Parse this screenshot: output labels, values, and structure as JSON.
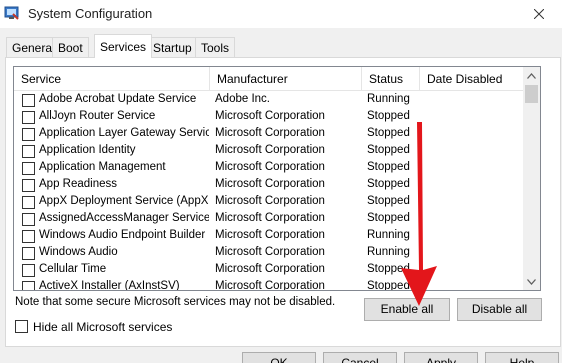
{
  "window": {
    "title": "System Configuration"
  },
  "tabs": [
    "General",
    "Boot",
    "Services",
    "Startup",
    "Tools"
  ],
  "active_tab": "Services",
  "columns": [
    "Service",
    "Manufacturer",
    "Status",
    "Date Disabled"
  ],
  "services": [
    {
      "service": "Adobe Acrobat Update Service",
      "manufacturer": "Adobe Inc.",
      "status": "Running",
      "checked": false
    },
    {
      "service": "AllJoyn Router Service",
      "manufacturer": "Microsoft Corporation",
      "status": "Stopped",
      "checked": false
    },
    {
      "service": "Application Layer Gateway Service",
      "manufacturer": "Microsoft Corporation",
      "status": "Stopped",
      "checked": false
    },
    {
      "service": "Application Identity",
      "manufacturer": "Microsoft Corporation",
      "status": "Stopped",
      "checked": false
    },
    {
      "service": "Application Management",
      "manufacturer": "Microsoft Corporation",
      "status": "Stopped",
      "checked": false
    },
    {
      "service": "App Readiness",
      "manufacturer": "Microsoft Corporation",
      "status": "Stopped",
      "checked": false
    },
    {
      "service": "AppX Deployment Service (AppX...",
      "manufacturer": "Microsoft Corporation",
      "status": "Stopped",
      "checked": false
    },
    {
      "service": "AssignedAccessManager Service",
      "manufacturer": "Microsoft Corporation",
      "status": "Stopped",
      "checked": false
    },
    {
      "service": "Windows Audio Endpoint Builder",
      "manufacturer": "Microsoft Corporation",
      "status": "Running",
      "checked": false
    },
    {
      "service": "Windows Audio",
      "manufacturer": "Microsoft Corporation",
      "status": "Running",
      "checked": false
    },
    {
      "service": "Cellular Time",
      "manufacturer": "Microsoft Corporation",
      "status": "Stopped",
      "checked": false
    },
    {
      "service": "ActiveX Installer (AxInstSV)",
      "manufacturer": "Microsoft Corporation",
      "status": "Stopped",
      "checked": false
    }
  ],
  "note": "Note that some secure Microsoft services may not be disabled.",
  "buttons": {
    "enable_all": "Enable all",
    "disable_all": "Disable all",
    "ok": "OK",
    "cancel": "Cancel",
    "apply": "Apply",
    "help": "Help"
  },
  "hide_microsoft": {
    "label": "Hide all Microsoft services",
    "checked": false
  },
  "icons": {
    "app": "system-configuration-icon",
    "close": "close-icon",
    "annotation": "red-arrow"
  },
  "colors": {
    "annotation_arrow": "#e3161b",
    "title_bar": "#ffffff",
    "panel": "#ffffff",
    "dialog_bg": "#f0f0f0"
  }
}
